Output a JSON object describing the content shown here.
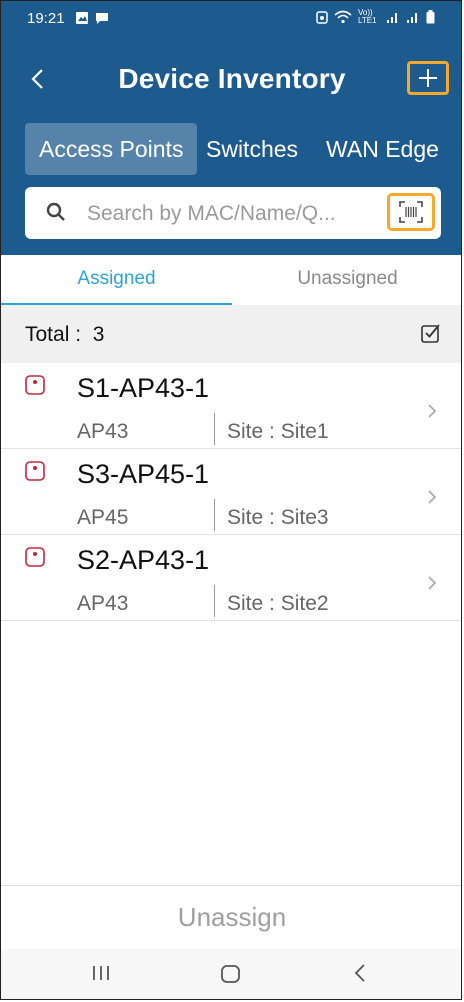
{
  "status_bar": {
    "time": "19:21",
    "carrier": "Vo)) LTE1"
  },
  "header": {
    "title": "Device Inventory",
    "back_icon": "chevron-left-icon",
    "add_icon": "plus-icon"
  },
  "type_tabs": [
    {
      "label": "Access Points",
      "active": true
    },
    {
      "label": "Switches",
      "active": false
    },
    {
      "label": "WAN Edge",
      "active": false
    }
  ],
  "search": {
    "placeholder": "Search by MAC/Name/Q...",
    "value": ""
  },
  "assign_tabs": [
    {
      "label": "Assigned",
      "active": true
    },
    {
      "label": "Unassigned",
      "active": false
    }
  ],
  "total": {
    "label": "Total :",
    "count": "3"
  },
  "devices": [
    {
      "name": "S1-AP43-1",
      "model": "AP43",
      "site": "Site : Site1"
    },
    {
      "name": "S3-AP45-1",
      "model": "AP45",
      "site": "Site : Site3"
    },
    {
      "name": "S2-AP43-1",
      "model": "AP43",
      "site": "Site : Site2"
    }
  ],
  "footer": {
    "unassign_label": "Unassign"
  },
  "colors": {
    "header_blue": "#1d5a8e",
    "highlight_orange": "#f4a92a",
    "active_tab": "#2aa5d8",
    "device_icon_red": "#c0283a"
  }
}
